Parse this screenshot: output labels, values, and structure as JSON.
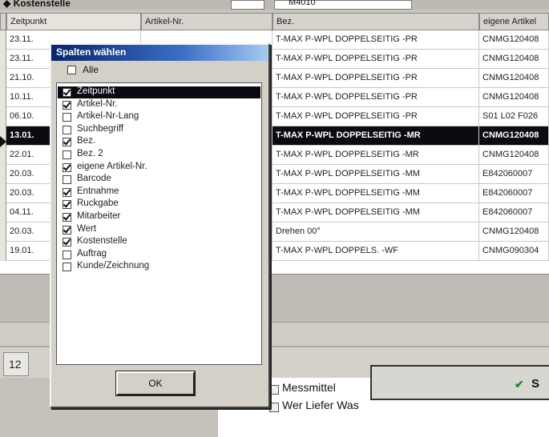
{
  "top": {
    "label": "Kostenstelle",
    "value": "M4010"
  },
  "grid": {
    "headers": [
      "Zeitpunkt",
      "Artikel-Nr.",
      "Bez.",
      "eigene Artikel"
    ],
    "rows": [
      {
        "zeit": "23.11.",
        "bez": "T-MAX P-WPL DOPPELSEITIG -PR",
        "eig": "CNMG120408"
      },
      {
        "zeit": "23.11.",
        "bez": "T-MAX P-WPL DOPPELSEITIG -PR",
        "eig": "CNMG120408"
      },
      {
        "zeit": "21.10.",
        "bez": "T-MAX P-WPL DOPPELSEITIG -PR",
        "eig": "CNMG120408"
      },
      {
        "zeit": "10.11.",
        "bez": "T-MAX P-WPL DOPPELSEITIG -PR",
        "eig": "CNMG120408"
      },
      {
        "zeit": "06.10.",
        "bez": "T-MAX P-WPL DOPPELSEITIG -PR",
        "eig": "S01 L02 F026"
      },
      {
        "zeit": "13.01.",
        "bez": "T-MAX P-WPL DOPPELSEITIG -MR",
        "eig": "CNMG120408"
      },
      {
        "zeit": "22.01.",
        "bez": "T-MAX P-WPL DOPPELSEITIG -MR",
        "eig": "CNMG120408"
      },
      {
        "zeit": "20.03.",
        "bez": "T-MAX P-WPL DOPPELSEITIG -MM",
        "eig": "E842060007"
      },
      {
        "zeit": "20.03.",
        "bez": "T-MAX P-WPL DOPPELSEITIG -MM",
        "eig": "E842060007"
      },
      {
        "zeit": "04.11.",
        "bez": "T-MAX P-WPL DOPPELSEITIG -MM",
        "eig": "E842060007"
      },
      {
        "zeit": "20.03.",
        "bez": "Drehen 00°",
        "eig": "CNMG120408"
      },
      {
        "zeit": "19.01.",
        "bez": "T-MAX P-WPL DOPPELS. -WF",
        "eig": "CNMG090304"
      }
    ],
    "selected_row": 5
  },
  "bottom": {
    "count": "12",
    "items": [
      "Messmittel",
      "Wer Liefer Was"
    ],
    "panel_letter": "S"
  },
  "dialog": {
    "title": "Spalten wählen",
    "alle_label": "Alle",
    "ok_label": "OK",
    "columns": [
      {
        "label": "Zeitpunkt",
        "checked": true,
        "selected": true
      },
      {
        "label": "Artikel-Nr.",
        "checked": true
      },
      {
        "label": "Artikel-Nr-Lang",
        "checked": false
      },
      {
        "label": "Suchbegriff",
        "checked": false
      },
      {
        "label": "Bez.",
        "checked": true
      },
      {
        "label": "Bez. 2",
        "checked": false
      },
      {
        "label": "eigene Artikel-Nr.",
        "checked": true
      },
      {
        "label": "Barcode",
        "checked": false
      },
      {
        "label": "Entnahme",
        "checked": true
      },
      {
        "label": "Ruckgabe",
        "checked": true
      },
      {
        "label": "Mitarbeiter",
        "checked": true
      },
      {
        "label": "Wert",
        "checked": true
      },
      {
        "label": "Kostenstelle",
        "checked": true
      },
      {
        "label": "Auftrag",
        "checked": false
      },
      {
        "label": "Kunde/Zeichnung",
        "checked": false
      }
    ]
  }
}
